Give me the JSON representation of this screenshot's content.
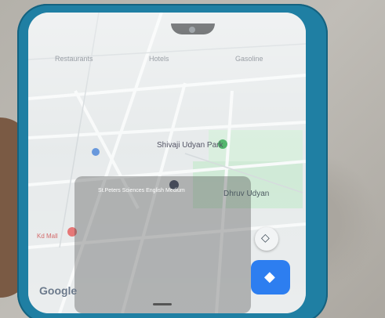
{
  "map": {
    "tabs": [
      "Restaurants",
      "Hotels",
      "Gasoline"
    ],
    "places": [
      {
        "name": "Shivaji Udyan Park"
      },
      {
        "name": "Dhruv Udyan"
      },
      {
        "name": "St.Peters Sciences English Medium"
      },
      {
        "name": "Kd Mall"
      }
    ],
    "brand": "Google"
  },
  "controls": {
    "compass_icon": "compass-icon",
    "directions_icon": "directions-icon"
  },
  "colors": {
    "phone_case": "#1f7fa3",
    "park_green": "#bfe3c8",
    "pin_green": "#35a853",
    "pin_dark": "#1f2a44",
    "pin_red": "#e05555",
    "directions_blue": "#2d7ef0"
  }
}
